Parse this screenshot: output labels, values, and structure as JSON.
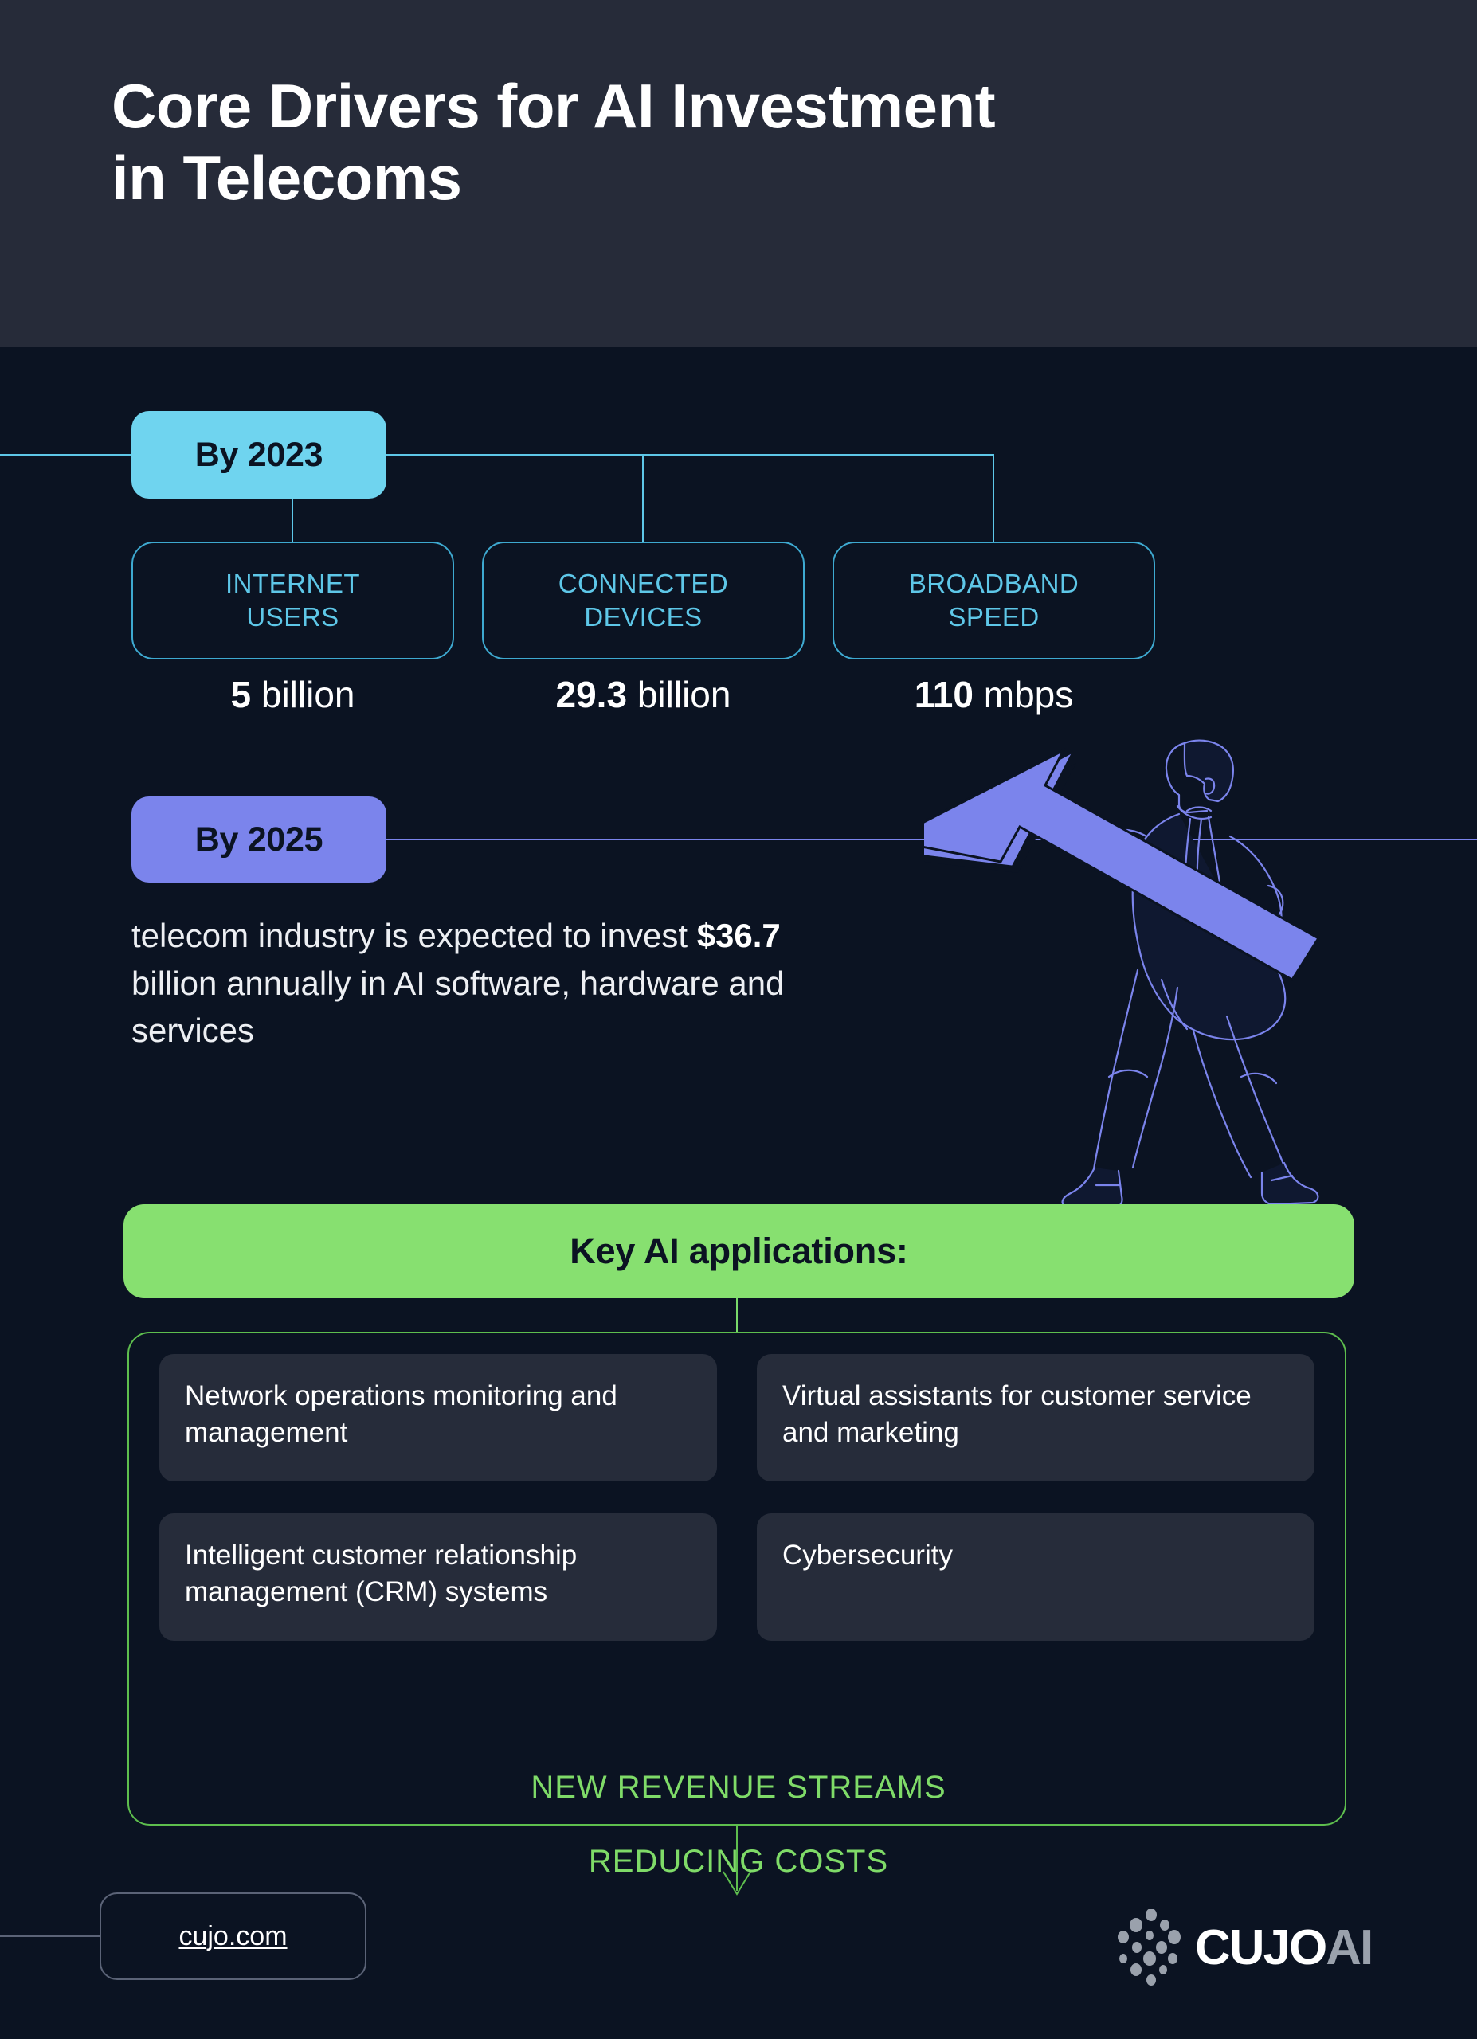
{
  "header": {
    "title_line1": "Core Drivers for AI Investment",
    "title_line2": "in Telecoms",
    "background": "#262B39"
  },
  "section_2023": {
    "badge_label": "By 2023",
    "badge_color": "#6FD4EF",
    "stats": [
      {
        "label_line1": "INTERNET",
        "label_line2": "USERS",
        "value_number": "5",
        "value_unit": "billion"
      },
      {
        "label_line1": "CONNECTED",
        "label_line2": "DEVICES",
        "value_number": "29.3",
        "value_unit": "billion"
      },
      {
        "label_line1": "BROADBAND",
        "label_line2": "SPEED",
        "value_number": "110",
        "value_unit": "mbps"
      }
    ],
    "accent_color": "#5EC7E8"
  },
  "section_2025": {
    "badge_label": "By 2025",
    "badge_color": "#7B84EC",
    "text_part1": "telecom industry is expected to invest ",
    "text_highlight": "$36.7",
    "text_part2": " billion annually in AI software, hardware and services",
    "illustration": "man-carrying-up-arrow"
  },
  "applications": {
    "title": "Key AI applications:",
    "title_bar_color": "#87E070",
    "items": [
      "Network operations monitoring and management",
      "Virtual assistants for customer service and marketing",
      "Intelligent customer relationship management (CRM) systems",
      "Cybersecurity"
    ]
  },
  "outcomes": {
    "line1": "NEW REVENUE STREAMS",
    "line2": "REDUCING COSTS",
    "color": "#7FDB68"
  },
  "footer": {
    "website": "cujo.com",
    "logo_primary": "CUJO",
    "logo_secondary": "AI",
    "logo_mark": "cujo-dot-grid-icon"
  }
}
